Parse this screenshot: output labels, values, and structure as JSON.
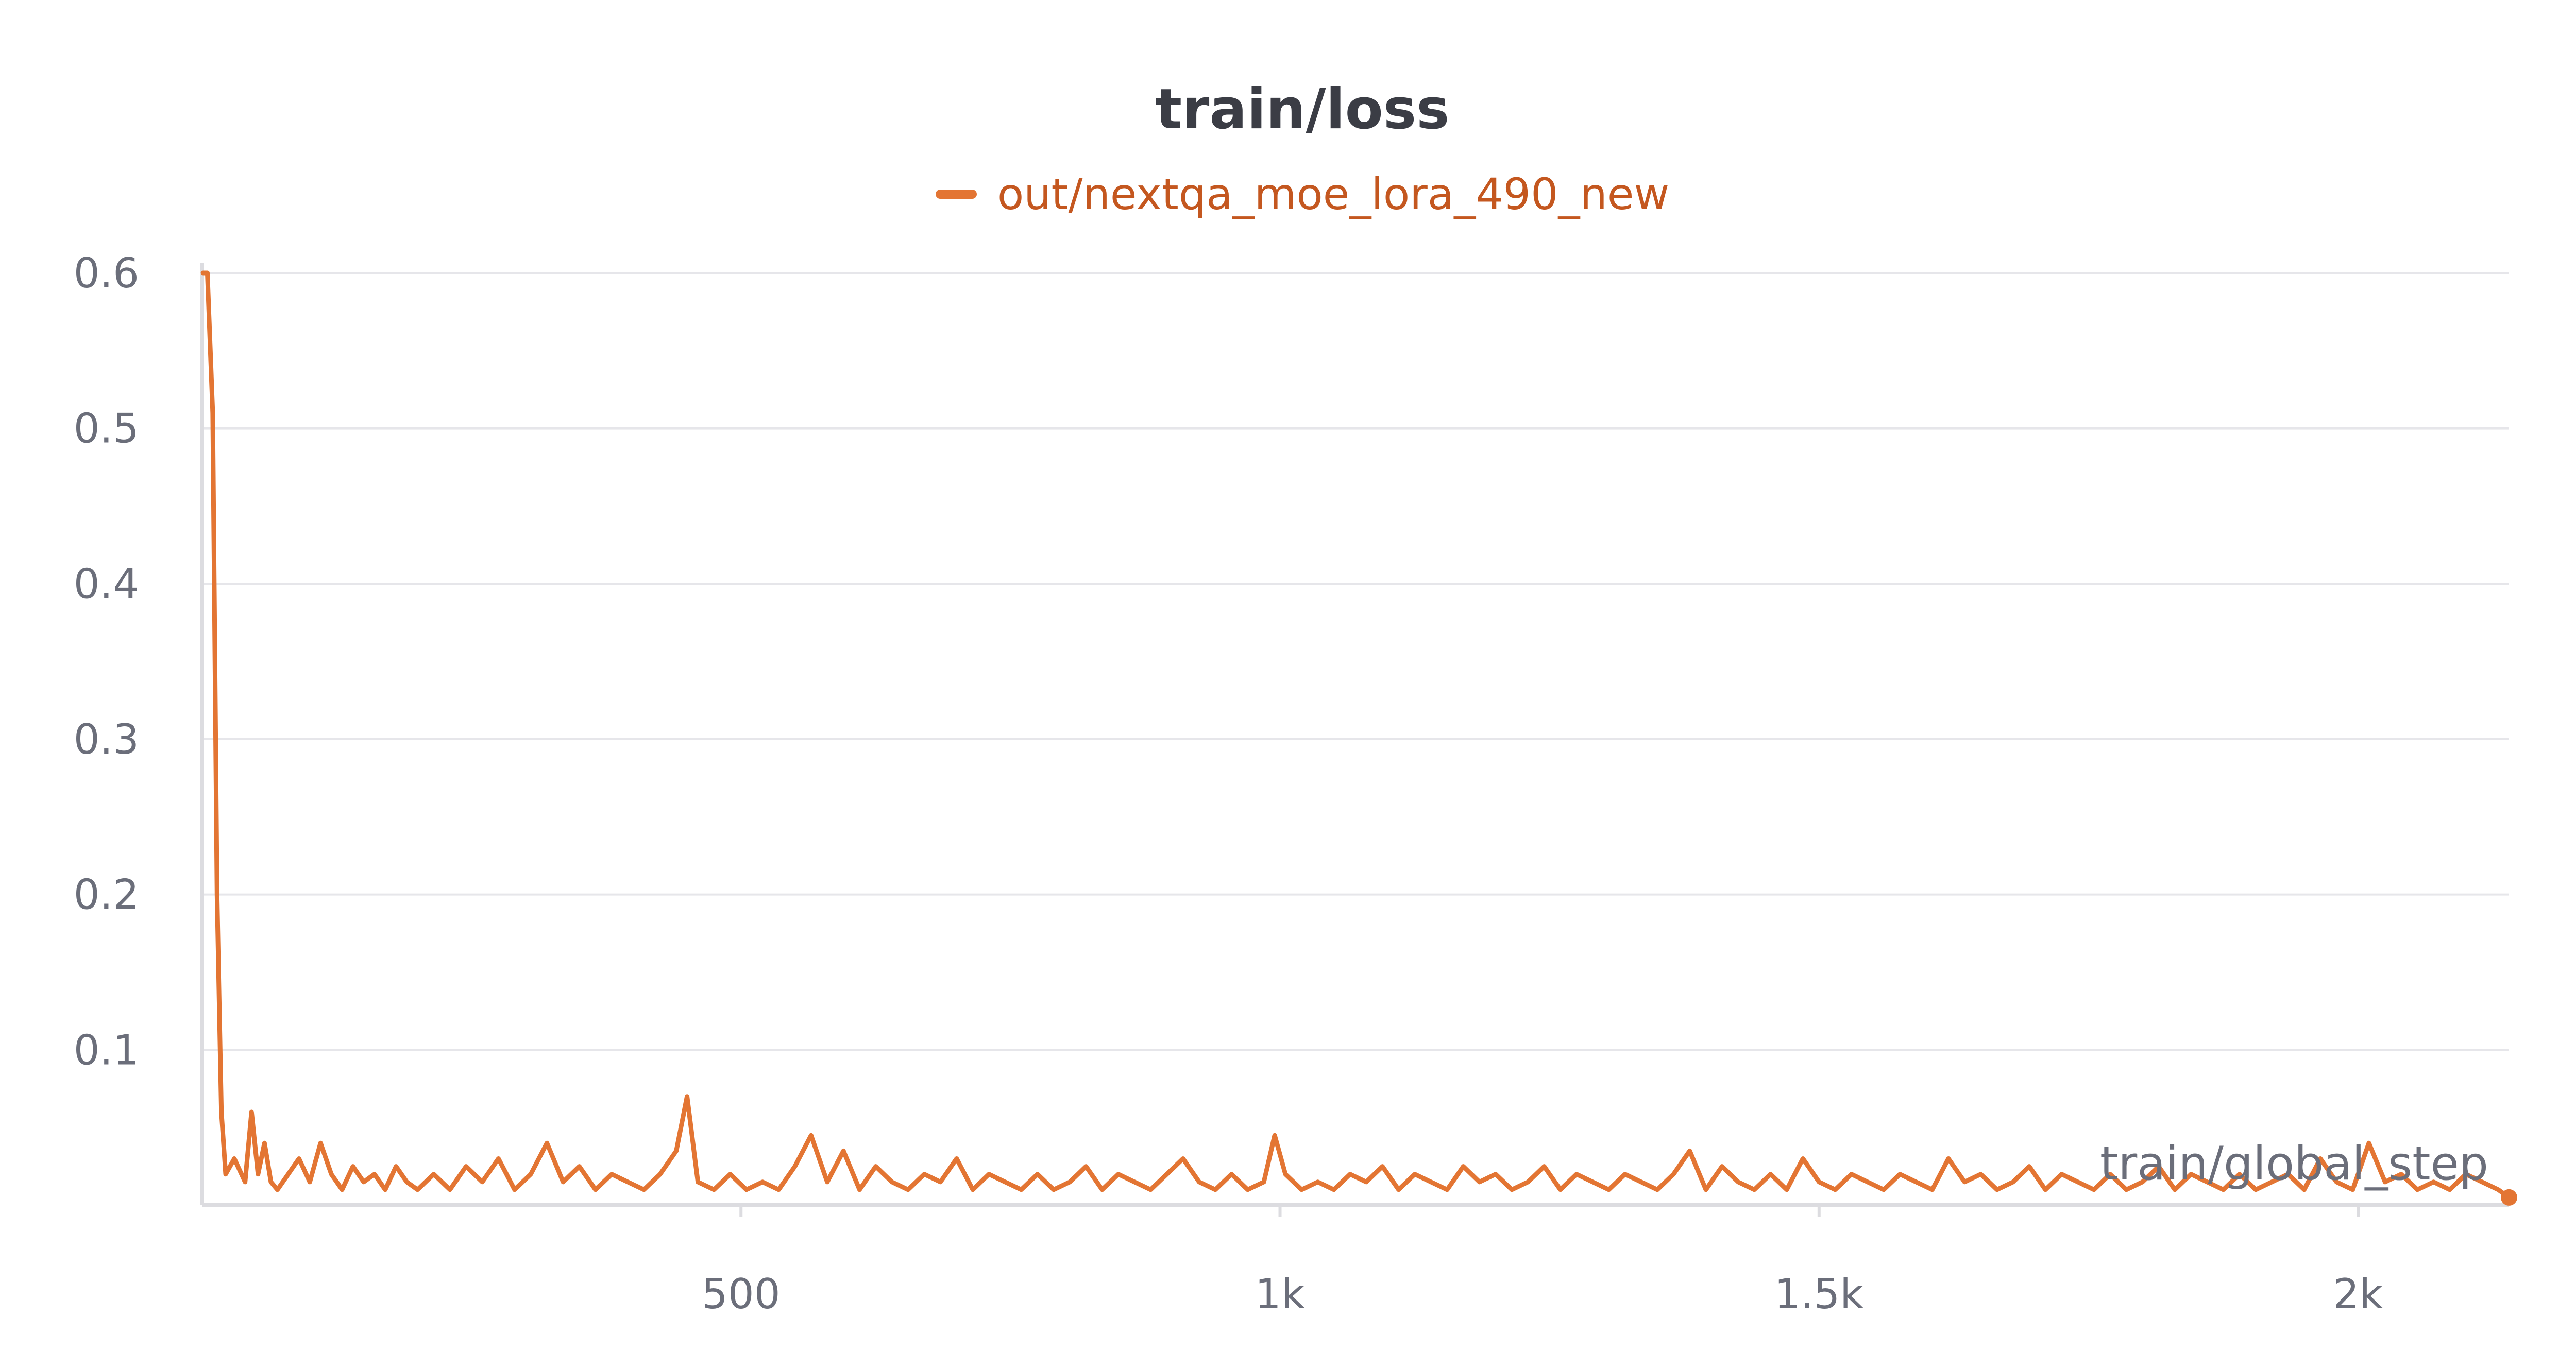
{
  "chart_data": {
    "type": "line",
    "title": "train/loss",
    "xlabel": "train/global_step",
    "ylabel": "",
    "xlim": [
      0,
      2140
    ],
    "ylim": [
      0,
      0.6
    ],
    "x_ticks": [
      500,
      1000,
      1500,
      2000
    ],
    "x_tick_labels": [
      "500",
      "1k",
      "1.5k",
      "2k"
    ],
    "y_ticks": [
      0.1,
      0.2,
      0.3,
      0.4,
      0.5,
      0.6
    ],
    "y_tick_labels": [
      "0.1",
      "0.2",
      "0.3",
      "0.4",
      "0.5",
      "0.6"
    ],
    "grid": true,
    "legend_position": "top-center",
    "series": [
      {
        "name": "out/nextqa_moe_lora_490_new",
        "color": "#e37533",
        "x": [
          1,
          5,
          10,
          14,
          18,
          22,
          30,
          40,
          46,
          52,
          58,
          64,
          70,
          80,
          90,
          100,
          110,
          120,
          130,
          140,
          150,
          160,
          170,
          180,
          190,
          200,
          215,
          230,
          245,
          260,
          275,
          290,
          305,
          320,
          335,
          350,
          365,
          380,
          395,
          410,
          425,
          440,
          450,
          460,
          475,
          490,
          505,
          520,
          535,
          550,
          565,
          580,
          595,
          610,
          625,
          640,
          655,
          670,
          685,
          700,
          715,
          730,
          745,
          760,
          775,
          790,
          805,
          820,
          835,
          850,
          865,
          880,
          895,
          910,
          925,
          940,
          955,
          970,
          985,
          995,
          1005,
          1020,
          1035,
          1050,
          1065,
          1080,
          1095,
          1110,
          1125,
          1140,
          1155,
          1170,
          1185,
          1200,
          1215,
          1230,
          1245,
          1260,
          1275,
          1290,
          1305,
          1320,
          1335,
          1350,
          1365,
          1380,
          1395,
          1410,
          1425,
          1440,
          1455,
          1470,
          1485,
          1500,
          1515,
          1530,
          1545,
          1560,
          1575,
          1590,
          1605,
          1620,
          1635,
          1650,
          1665,
          1680,
          1695,
          1710,
          1725,
          1740,
          1755,
          1770,
          1785,
          1800,
          1815,
          1830,
          1845,
          1860,
          1875,
          1890,
          1905,
          1920,
          1935,
          1950,
          1965,
          1980,
          1995,
          2010,
          2025,
          2040,
          2055,
          2070,
          2085,
          2100,
          2115,
          2130,
          2140
        ],
        "values": [
          0.6,
          0.6,
          0.51,
          0.2,
          0.06,
          0.02,
          0.03,
          0.015,
          0.06,
          0.02,
          0.04,
          0.015,
          0.01,
          0.02,
          0.03,
          0.015,
          0.04,
          0.02,
          0.01,
          0.025,
          0.015,
          0.02,
          0.01,
          0.025,
          0.015,
          0.01,
          0.02,
          0.01,
          0.025,
          0.015,
          0.03,
          0.01,
          0.02,
          0.04,
          0.015,
          0.025,
          0.01,
          0.02,
          0.015,
          0.01,
          0.02,
          0.035,
          0.07,
          0.015,
          0.01,
          0.02,
          0.01,
          0.015,
          0.01,
          0.025,
          0.045,
          0.015,
          0.035,
          0.01,
          0.025,
          0.015,
          0.01,
          0.02,
          0.015,
          0.03,
          0.01,
          0.02,
          0.015,
          0.01,
          0.02,
          0.01,
          0.015,
          0.025,
          0.01,
          0.02,
          0.015,
          0.01,
          0.02,
          0.03,
          0.015,
          0.01,
          0.02,
          0.01,
          0.015,
          0.045,
          0.02,
          0.01,
          0.015,
          0.01,
          0.02,
          0.015,
          0.025,
          0.01,
          0.02,
          0.015,
          0.01,
          0.025,
          0.015,
          0.02,
          0.01,
          0.015,
          0.025,
          0.01,
          0.02,
          0.015,
          0.01,
          0.02,
          0.015,
          0.01,
          0.02,
          0.035,
          0.01,
          0.025,
          0.015,
          0.01,
          0.02,
          0.01,
          0.03,
          0.015,
          0.01,
          0.02,
          0.015,
          0.01,
          0.02,
          0.015,
          0.01,
          0.03,
          0.015,
          0.02,
          0.01,
          0.015,
          0.025,
          0.01,
          0.02,
          0.015,
          0.01,
          0.02,
          0.01,
          0.015,
          0.025,
          0.01,
          0.02,
          0.015,
          0.01,
          0.02,
          0.01,
          0.015,
          0.02,
          0.01,
          0.03,
          0.015,
          0.01,
          0.04,
          0.015,
          0.02,
          0.01,
          0.015,
          0.01,
          0.02,
          0.015,
          0.01,
          0.005
        ]
      }
    ]
  }
}
